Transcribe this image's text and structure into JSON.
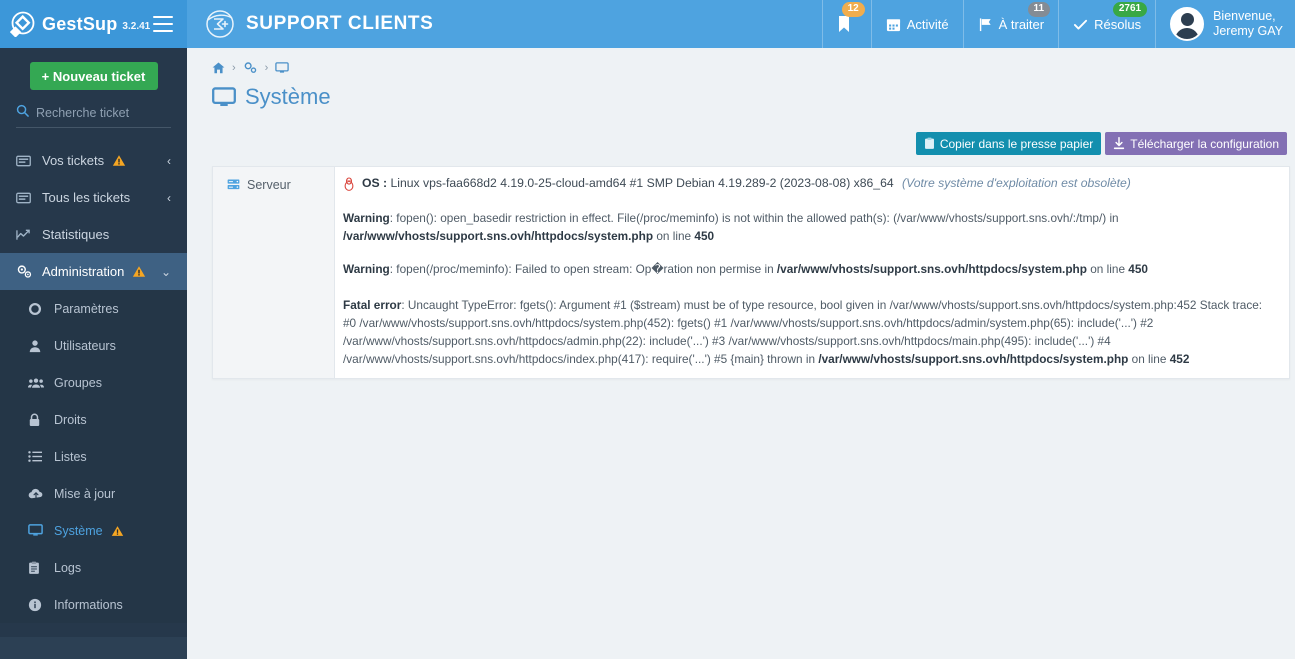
{
  "brand": {
    "name": "GestSup",
    "version": "3.2.41",
    "logo_icon": "gestsup-logo-icon",
    "menu_icon": "hamburger-menu-icon"
  },
  "header": {
    "app_title": "SUPPORT CLIENTS",
    "app_logo_icon": "sigma-plus-circle-icon",
    "items": [
      {
        "name": "bookmark",
        "label": "",
        "icon": "bookmark-icon",
        "badge": "12",
        "badge_color": "#f0ad4e"
      },
      {
        "name": "activite",
        "label": "Activité",
        "icon": "calendar-icon",
        "badge": "",
        "badge_color": ""
      },
      {
        "name": "a-traiter",
        "label": "À traiter",
        "icon": "flag-icon",
        "badge": "11",
        "badge_color": "#848c95"
      },
      {
        "name": "resolus",
        "label": "Résolus",
        "icon": "check-icon",
        "badge": "2761",
        "badge_color": "#39a845"
      }
    ],
    "user": {
      "greeting": "Bienvenue,",
      "name": "Jeremy GAY",
      "avatar_icon": "user-avatar-icon"
    }
  },
  "sidebar": {
    "new_ticket_label": "+ Nouveau ticket",
    "search": {
      "placeholder": "Recherche ticket",
      "value": "",
      "icon": "search-icon"
    },
    "items": [
      {
        "label": "Vos tickets",
        "icon": "ticket-icon",
        "warning": true,
        "chevron": "‹",
        "active": false
      },
      {
        "label": "Tous les tickets",
        "icon": "ticket-icon",
        "warning": false,
        "chevron": "‹",
        "active": false
      },
      {
        "label": "Statistiques",
        "icon": "chart-line-icon",
        "warning": false,
        "chevron": "",
        "active": false
      },
      {
        "label": "Administration",
        "icon": "gears-icon",
        "warning": true,
        "chevron": "⌄",
        "active": true
      }
    ],
    "subitems": [
      {
        "label": "Paramètres",
        "icon": "gear-icon",
        "current": false
      },
      {
        "label": "Utilisateurs",
        "icon": "user-icon",
        "current": false
      },
      {
        "label": "Groupes",
        "icon": "users-icon",
        "current": false
      },
      {
        "label": "Droits",
        "icon": "lock-icon",
        "current": false
      },
      {
        "label": "Listes",
        "icon": "list-icon",
        "current": false
      },
      {
        "label": "Mise à jour",
        "icon": "cloud-upload-icon",
        "current": false
      },
      {
        "label": "Système",
        "icon": "monitor-icon",
        "current": true,
        "warning": true
      },
      {
        "label": "Logs",
        "icon": "clipboard-icon",
        "current": false
      },
      {
        "label": "Informations",
        "icon": "info-circle-icon",
        "current": false
      }
    ]
  },
  "main": {
    "breadcrumb": [
      {
        "icon": "home-icon",
        "name": "home"
      },
      {
        "icon": "gears-icon",
        "name": "administration"
      },
      {
        "icon": "monitor-icon",
        "name": "systeme"
      }
    ],
    "breadcrumb_separator": "›",
    "page_title": "Système",
    "page_title_icon": "monitor-icon",
    "buttons": [
      {
        "label": "Copier dans le presse papier",
        "icon": "clipboard-icon",
        "color": "#138fae"
      },
      {
        "label": "Télécharger la configuration",
        "icon": "download-icon",
        "color": "#8370b4"
      }
    ],
    "panel": {
      "label": "Serveur",
      "label_icon": "server-icon",
      "os": {
        "icon": "tux-linux-icon",
        "key": "OS :",
        "value": "Linux vps-faa668d2 4.19.0-25-cloud-amd64 #1 SMP Debian 4.19.289-2 (2023-08-08) x86_64",
        "note": "(Votre système d'exploitation est obsolète)"
      },
      "messages": [
        {
          "kind": "warning",
          "label": "Warning",
          "parts": [
            {
              "text": ": fopen(): open_basedir restriction in effect. File(/proc/meminfo) is not within the allowed path(s): (/var/www/vhosts/support.sns.ovh/:/tmp/) in ",
              "bold": false
            },
            {
              "text": "/var/www/vhosts/support.sns.ovh/httpdocs/system.php",
              "bold": true
            },
            {
              "text": " on line ",
              "bold": false
            },
            {
              "text": "450",
              "bold": true
            }
          ]
        },
        {
          "kind": "warning",
          "label": "Warning",
          "parts": [
            {
              "text": ": fopen(/proc/meminfo): Failed to open stream: Op�ration non permise in ",
              "bold": false
            },
            {
              "text": "/var/www/vhosts/support.sns.ovh/httpdocs/system.php",
              "bold": true
            },
            {
              "text": " on line ",
              "bold": false
            },
            {
              "text": "450",
              "bold": true
            }
          ]
        },
        {
          "kind": "fatal",
          "label": "Fatal error",
          "parts": [
            {
              "text": ": Uncaught TypeError: fgets(): Argument #1 ($stream) must be of type resource, bool given in /var/www/vhosts/support.sns.ovh/httpdocs/system.php:452 Stack trace: #0 /var/www/vhosts/support.sns.ovh/httpdocs/system.php(452): fgets() #1 /var/www/vhosts/support.sns.ovh/httpdocs/admin/system.php(65): include('...') #2 /var/www/vhosts/support.sns.ovh/httpdocs/admin.php(22): include('...') #3 /var/www/vhosts/support.sns.ovh/httpdocs/main.php(495): include('...') #4 /var/www/vhosts/support.sns.ovh/httpdocs/index.php(417): require('...') #5 {main} thrown in ",
              "bold": false
            },
            {
              "text": "/var/www/vhosts/support.sns.ovh/httpdocs/system.php",
              "bold": true
            },
            {
              "text": " on line ",
              "bold": false
            },
            {
              "text": "452",
              "bold": true
            }
          ]
        }
      ]
    }
  },
  "colors": {
    "brand_blue": "#3c97d9",
    "header_blue": "#4ea3e0",
    "sidebar_dark": "#26384b",
    "sidebar_active": "#3e6183",
    "green_button": "#34a853",
    "accent_link": "#4a90c8",
    "warning_amber": "#f5a623"
  }
}
